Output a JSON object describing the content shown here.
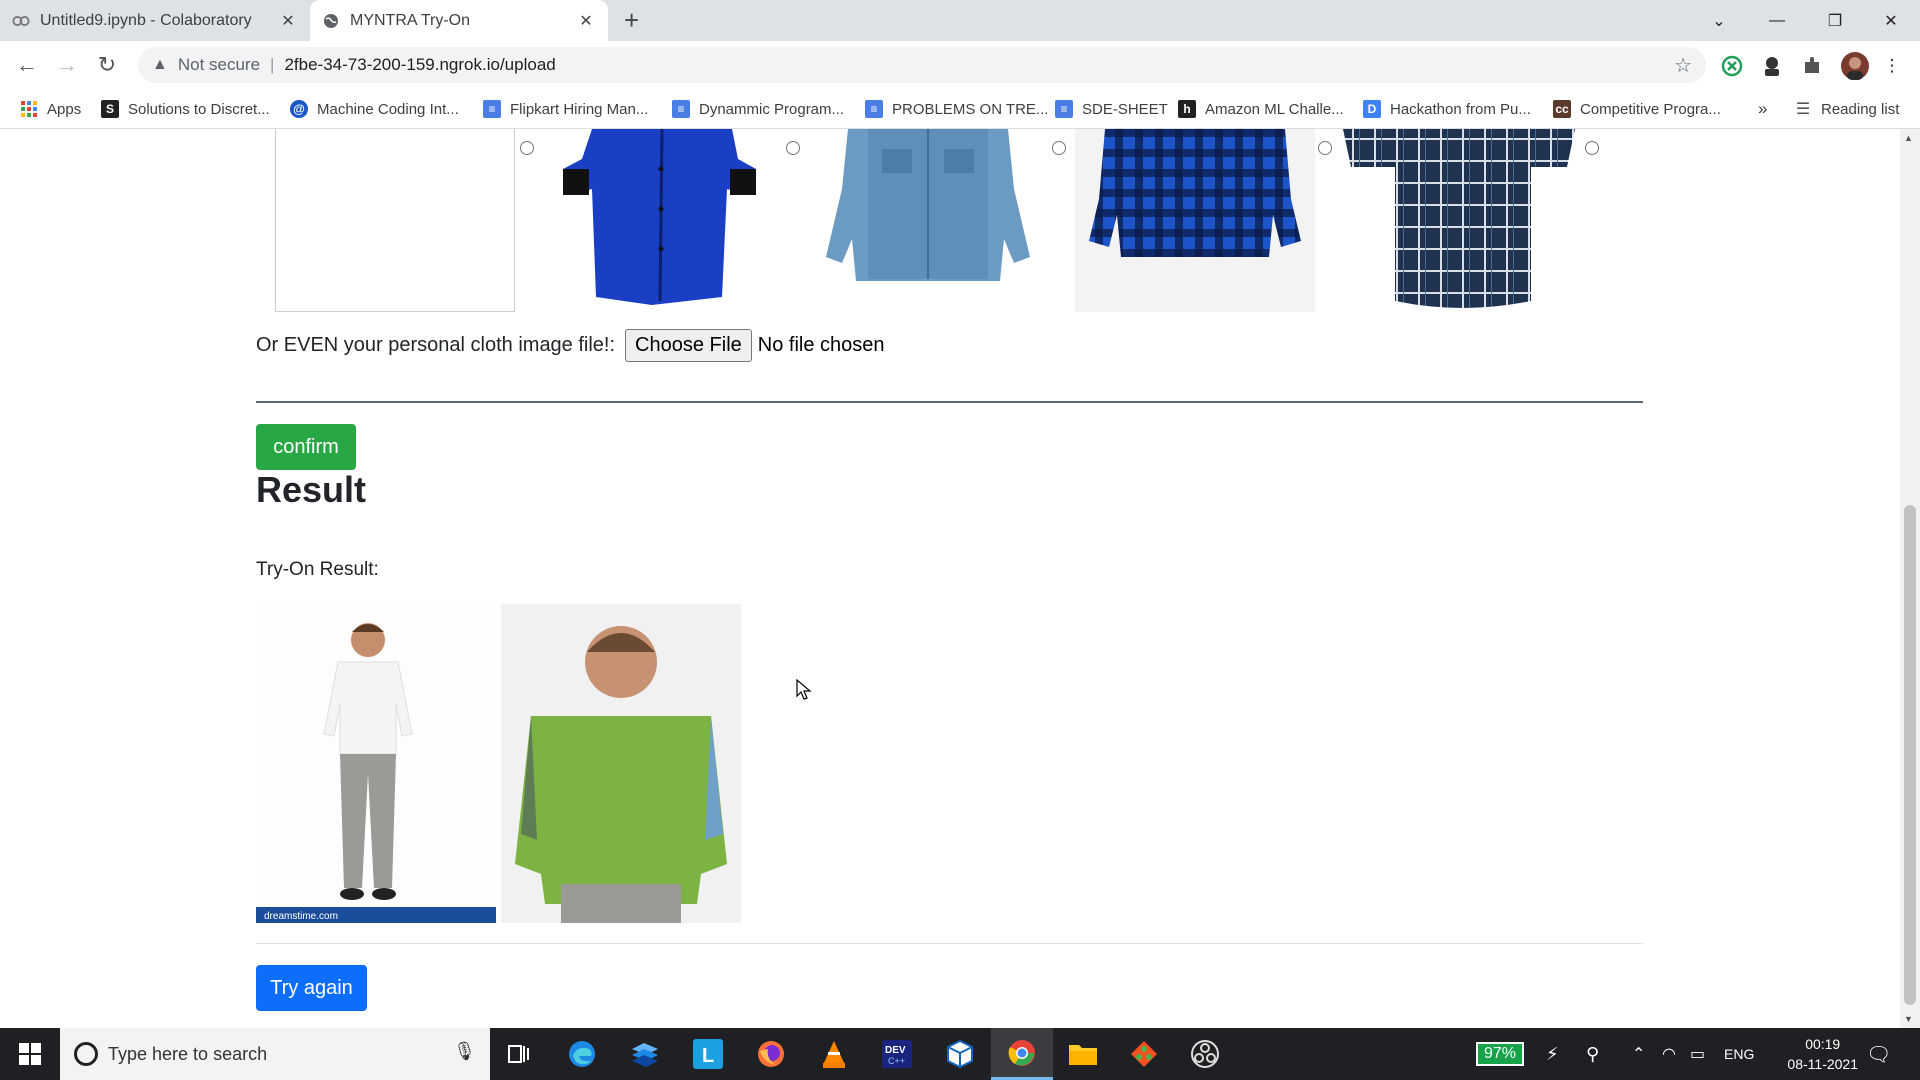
{
  "browser": {
    "tabs": [
      {
        "title": "Untitled9.ipynb - Colaboratory",
        "active": false
      },
      {
        "title": "MYNTRA Try-On",
        "active": true
      }
    ],
    "security_label": "Not secure",
    "url": "2fbe-34-73-200-159.ngrok.io/upload",
    "bookmarks": [
      {
        "label": "Apps",
        "icon": "apps-grid-icon"
      },
      {
        "label": "Solutions to Discret...",
        "icon": "s-badge-icon"
      },
      {
        "label": "Machine Coding Int...",
        "icon": "at-sign-icon"
      },
      {
        "label": "Flipkart Hiring Man...",
        "icon": "doc-icon"
      },
      {
        "label": "Dynammic Program...",
        "icon": "doc-icon"
      },
      {
        "label": "PROBLEMS ON TRE...",
        "icon": "doc-icon"
      },
      {
        "label": "SDE-SHEET",
        "icon": "doc-icon"
      },
      {
        "label": "Amazon ML Challe...",
        "icon": "h-badge-icon"
      },
      {
        "label": "Hackathon from Pu...",
        "icon": "dc-badge-icon"
      },
      {
        "label": "Competitive Progra...",
        "icon": "cc-badge-icon"
      }
    ],
    "overflow": "»",
    "reading_list": "Reading list"
  },
  "page": {
    "cloth_options": [
      {
        "name": "placeholder"
      },
      {
        "name": "blue-shirt-black-cuffs",
        "color": "#1a3fc4"
      },
      {
        "name": "denim-shirt",
        "color": "#5f8fb8"
      },
      {
        "name": "blue-black-plaid-shirt",
        "color": "#1d54c8"
      },
      {
        "name": "navy-plaid-shirt",
        "color": "#1f3350"
      }
    ],
    "file_label": "Or EVEN your personal cloth image file!:",
    "choose_file": "Choose File",
    "no_file": "No file chosen",
    "confirm_label": "confirm",
    "result_heading": "Result",
    "tryon_label": "Try-On Result:",
    "result_images": [
      {
        "name": "person-original-image",
        "watermark": "dreamstime.com"
      },
      {
        "name": "person-tryon-output-image"
      }
    ],
    "try_again_label": "Try again"
  },
  "taskbar": {
    "search_placeholder": "Type here to search",
    "battery": "97%",
    "language": "ENG",
    "time": "00:19",
    "date": "08-11-2021"
  },
  "colors": {
    "confirm": "#28a745",
    "try_again": "#0d6efd",
    "battery": "#16a34a"
  }
}
